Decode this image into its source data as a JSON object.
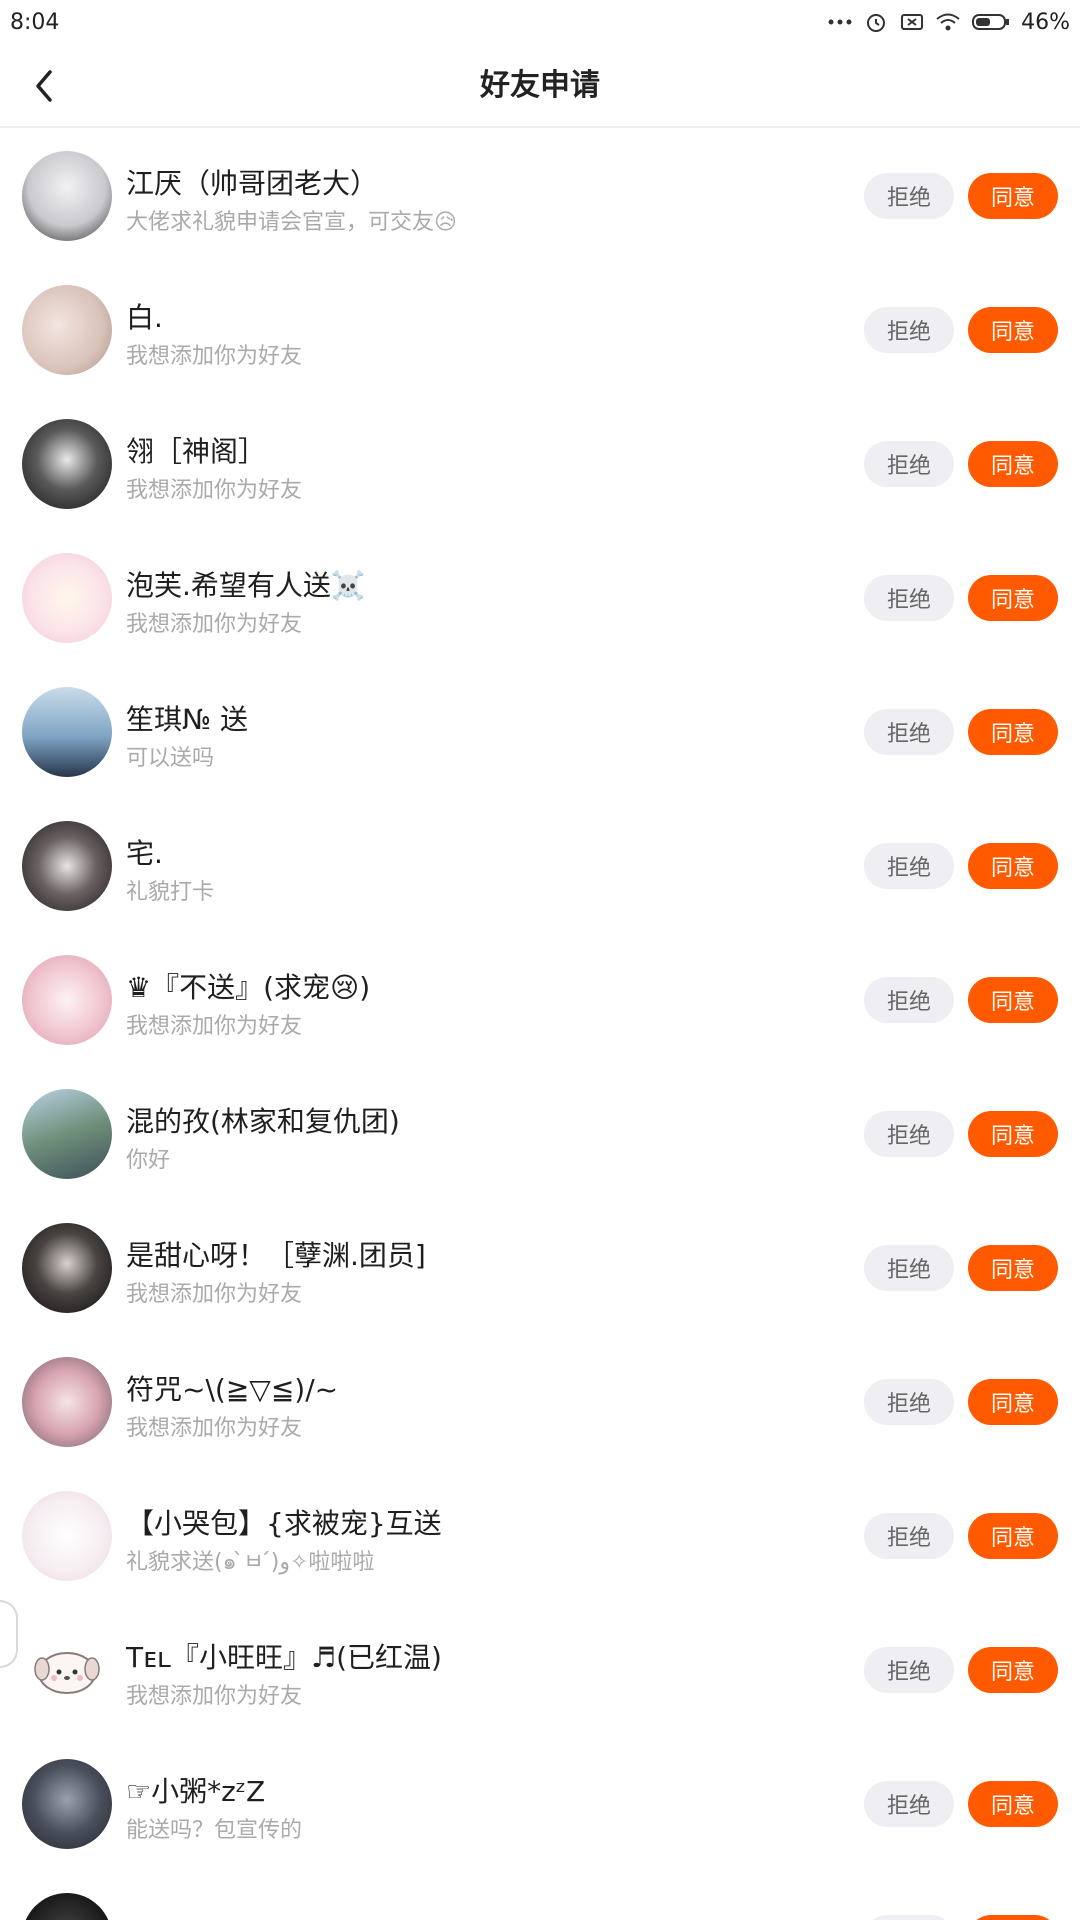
{
  "status_bar": {
    "time": "8:04",
    "battery": "46%"
  },
  "header": {
    "title": "好友申请"
  },
  "buttons": {
    "reject": "拒绝",
    "accept": "同意"
  },
  "colors": {
    "accent": "#ff5a00",
    "reject_bg": "#eeeef3",
    "subtext": "#aaaaaa"
  },
  "requests": [
    {
      "name": "江厌（帅哥团老大）",
      "message": "大佬求礼貌申请会官宣，可交友😥",
      "avatar_color": "#d8d8dc"
    },
    {
      "name": "白.",
      "message": "我想添加你为好友",
      "avatar_color": "#e8d6d0"
    },
    {
      "name": "翎［神阁］",
      "message": "我想添加你为好友",
      "avatar_color": "#2b2b2b"
    },
    {
      "name": "泡芙.希望有人送☠️",
      "message": "我想添加你为好友",
      "avatar_color": "#f7dfe6"
    },
    {
      "name": "笙琪№ 送",
      "message": "可以送吗",
      "avatar_color": "#8fb1cf"
    },
    {
      "name": "宅.",
      "message": "礼貌打卡",
      "avatar_color": "#3a3534"
    },
    {
      "name": "♛『不送』(求宠😢)",
      "message": "我想添加你为好友",
      "avatar_color": "#f2c9d2"
    },
    {
      "name": "混的孜(林家和复仇团)",
      "message": "你好",
      "avatar_color": "#6d8a9a"
    },
    {
      "name": "是甜心呀！［孽渊.团员]",
      "message": "我想添加你为好友",
      "avatar_color": "#1e1e1e"
    },
    {
      "name": "符咒~\\(≧▽≦)/~",
      "message": "我想添加你为好友",
      "avatar_color": "#c79aa6"
    },
    {
      "name": "【小哭包】{求被宠}互送",
      "message": "礼貌求送(๑ ̀ㅂ ́)و✧啦啦啦",
      "avatar_color": "#f5eef2"
    },
    {
      "name": "Tᴇʟ『小旺旺』♬(已红温)",
      "message": "我想添加你为好友",
      "avatar_color": "#ffffff"
    },
    {
      "name": "☞小粥*zᶻZ",
      "message": "能送吗？包宣传的",
      "avatar_color": "#4a4f5c"
    }
  ]
}
